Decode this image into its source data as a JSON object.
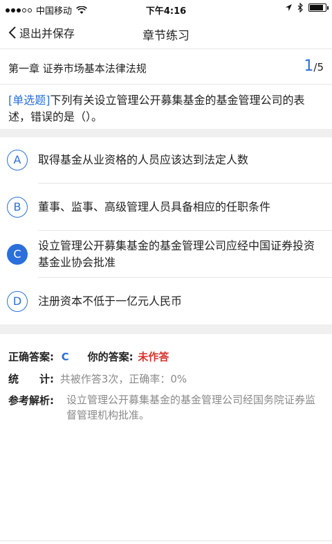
{
  "status_bar": {
    "carrier": "中国移动",
    "time": "下午4:16",
    "battery_level": 0.85
  },
  "nav": {
    "back_label": "退出并保存",
    "title": "章节练习"
  },
  "chapter": {
    "title": "第一章 证券市场基本法律法规",
    "current": "1",
    "total": "/5"
  },
  "question": {
    "type_label": "[单选题]",
    "text": "下列有关设立管理公开募集基金的基金管理公司的表述，错误的是（）。"
  },
  "options": [
    {
      "letter": "A",
      "text": "取得基金从业资格的人员应该达到法定人数",
      "selected": false
    },
    {
      "letter": "B",
      "text": "董事、监事、高级管理人员具备相应的任职条件",
      "selected": false
    },
    {
      "letter": "C",
      "text": "设立管理公开募集基金的基金管理公司应经中国证券投资基金业协会批准",
      "selected": true
    },
    {
      "letter": "D",
      "text": "注册资本不低于一亿元人民币",
      "selected": false
    }
  ],
  "answer": {
    "correct_label": "正确答案:",
    "correct_value": "C",
    "yours_label": "你的答案:",
    "yours_value": "未作答",
    "stats_label": "统　　计:",
    "stats_value": "共被作答3次，正确率：0%",
    "analysis_label": "参考解析:",
    "analysis_value": "设立管理公开募集基金的基金管理公司经国务院证券监督管理机构批准。"
  },
  "colors": {
    "accent": "#2a6fdb",
    "danger": "#d9332a",
    "muted": "#8a8a8a",
    "band": "#f0f0f0"
  }
}
